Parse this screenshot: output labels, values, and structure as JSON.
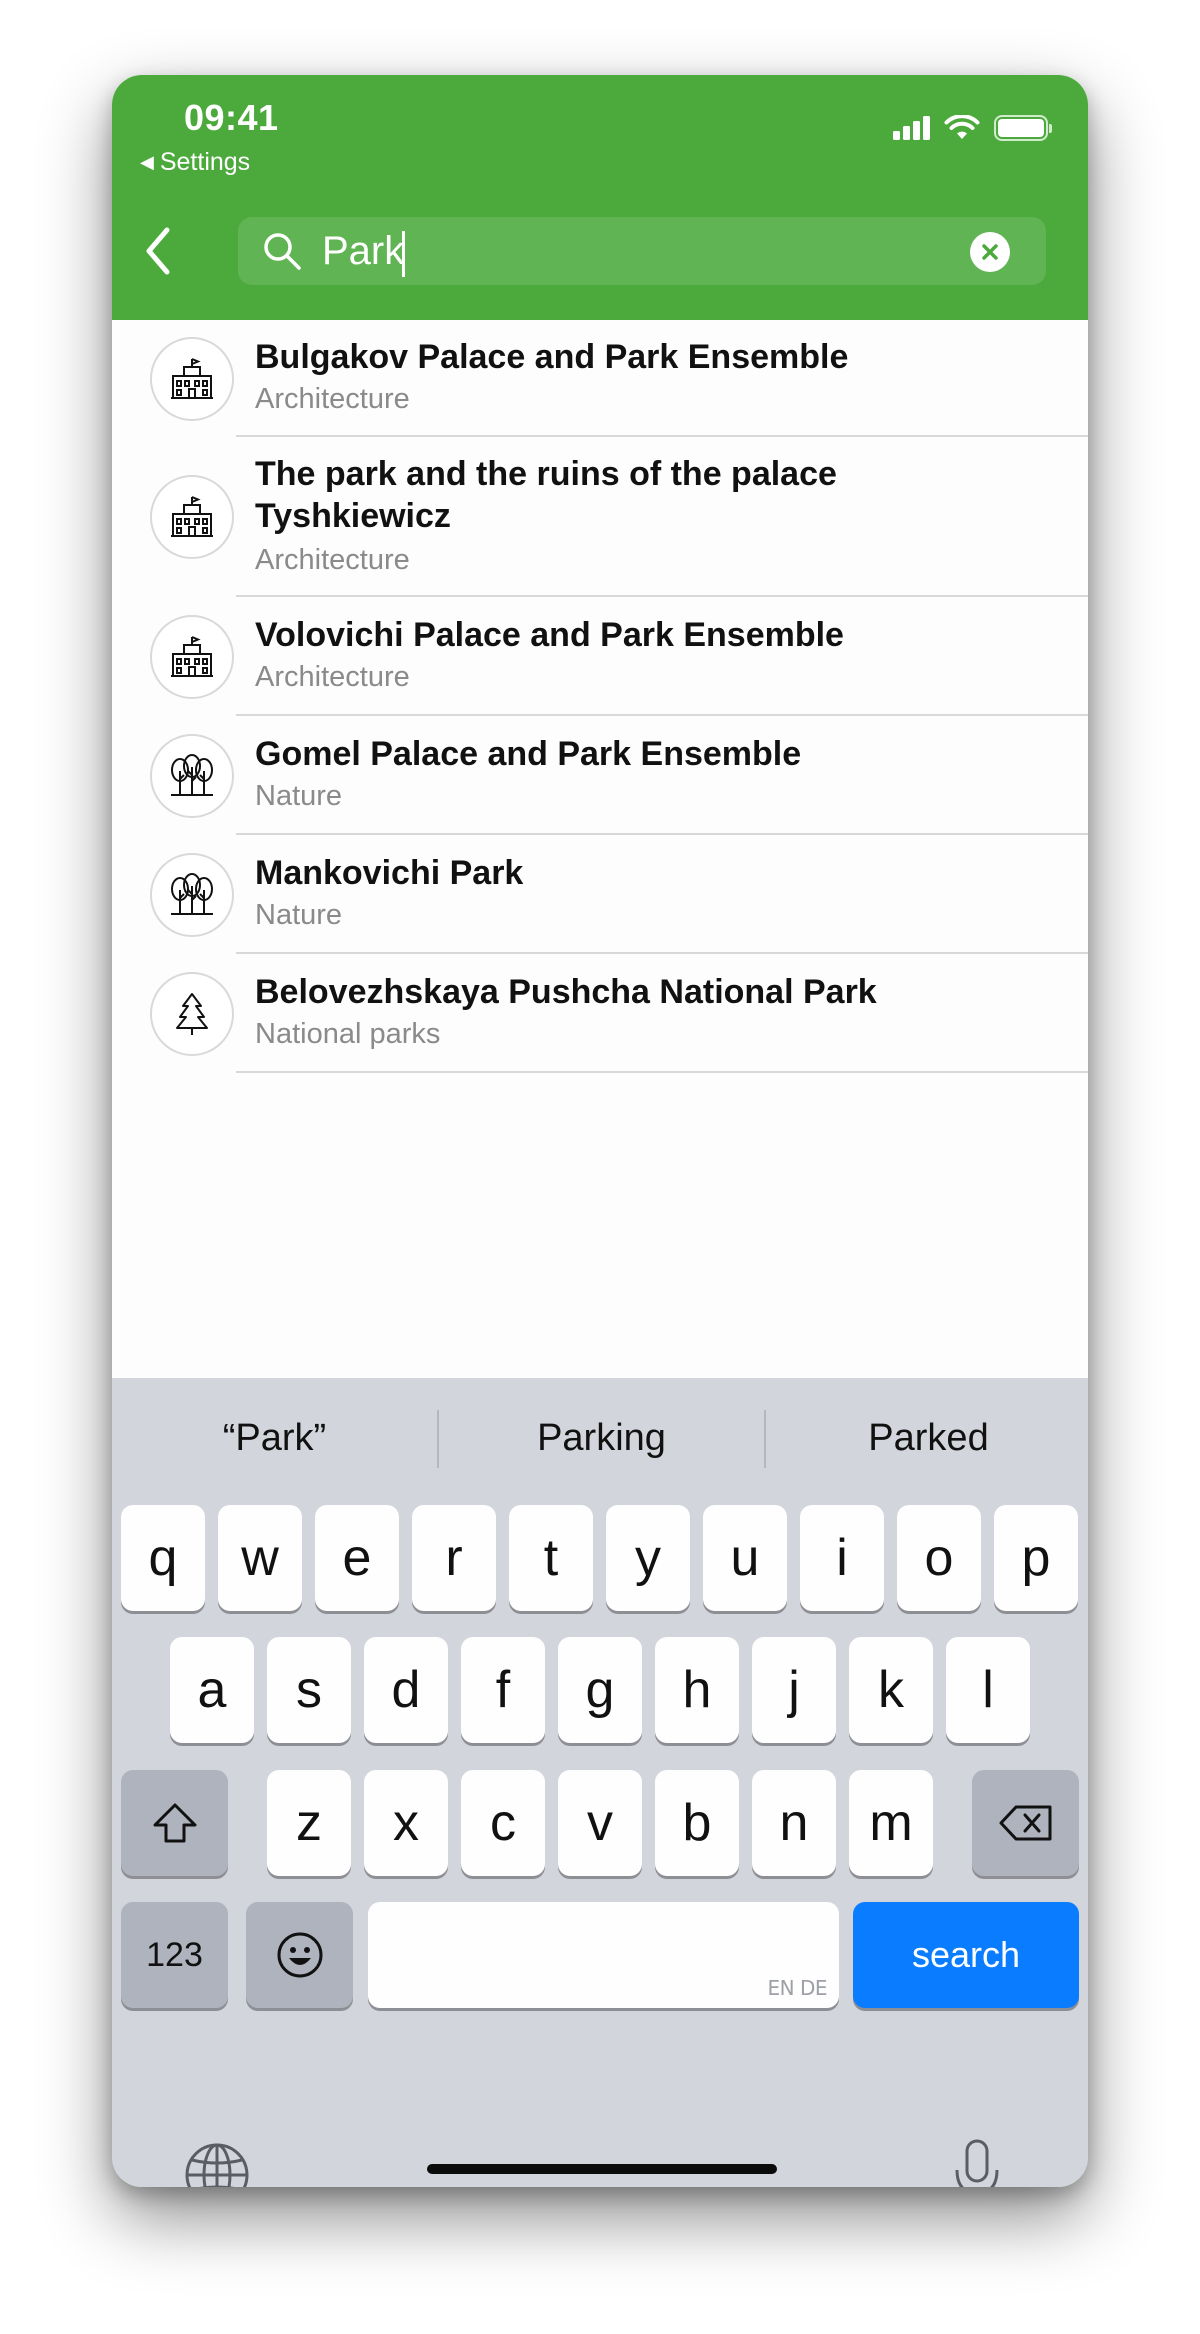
{
  "status_bar": {
    "time": "09:41",
    "back_app": "Settings"
  },
  "search": {
    "query": "Park"
  },
  "results": [
    {
      "title": "Bulgakov Palace and Park Ensemble",
      "category": "Architecture",
      "icon": "palace-icon"
    },
    {
      "title": "The park and the ruins of the palace Tyshkiewicz",
      "category": "Architecture",
      "icon": "palace-icon"
    },
    {
      "title": "Volovichi Palace and Park Ensemble",
      "category": "Architecture",
      "icon": "palace-icon"
    },
    {
      "title": "Gomel Palace and Park Ensemble",
      "category": "Nature",
      "icon": "trees-icon"
    },
    {
      "title": "Mankovichi Park",
      "category": "Nature",
      "icon": "trees-icon"
    },
    {
      "title": "Belovezhskaya Pushcha National Park",
      "category": "National parks",
      "icon": "pine-tree-icon"
    }
  ],
  "keyboard": {
    "suggestions": [
      "“Park”",
      "Parking",
      "Parked"
    ],
    "row1": [
      "q",
      "w",
      "e",
      "r",
      "t",
      "y",
      "u",
      "i",
      "o",
      "p"
    ],
    "row2": [
      "a",
      "s",
      "d",
      "f",
      "g",
      "h",
      "j",
      "k",
      "l"
    ],
    "row3": [
      "z",
      "x",
      "c",
      "v",
      "b",
      "n",
      "m"
    ],
    "numbers_label": "123",
    "space_hint": "EN DE",
    "action_label": "search"
  },
  "colors": {
    "header": "#4caa3c",
    "action_key": "#0a7cff"
  }
}
